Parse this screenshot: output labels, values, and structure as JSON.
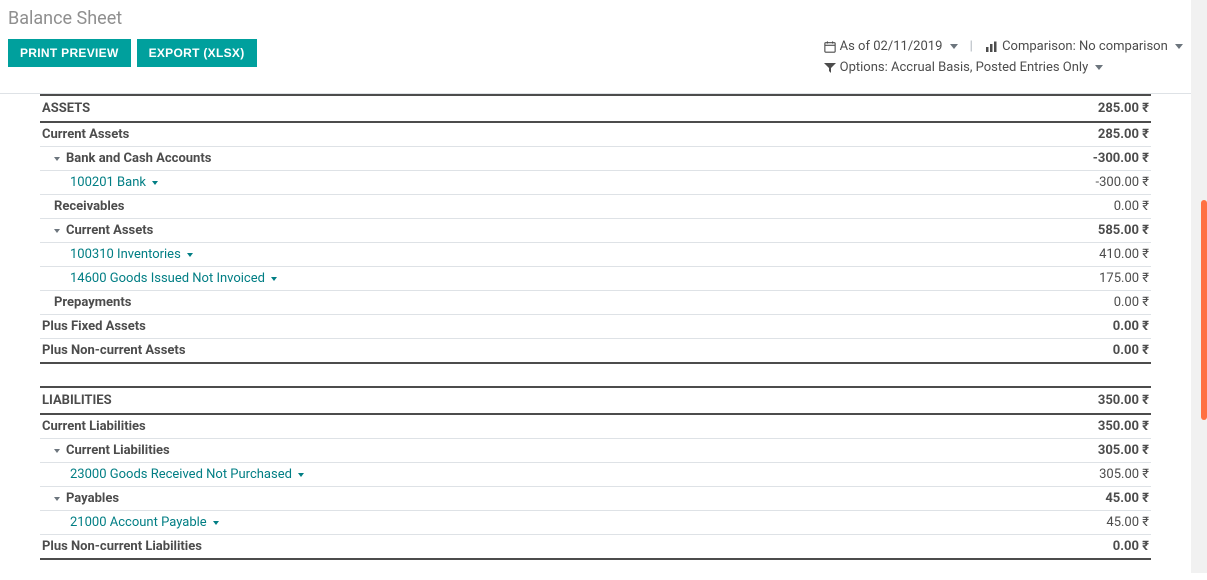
{
  "title": "Balance Sheet",
  "buttons": {
    "print": "PRINT PREVIEW",
    "export": "EXPORT (XLSX)"
  },
  "filters": {
    "asof_label": "As of",
    "asof_date": "02/11/2019",
    "comparison_label": "Comparison:",
    "comparison_value": "No comparison",
    "options_label": "Options:",
    "options_value": "Accrual Basis, Posted Entries Only"
  },
  "lines": {
    "assets": {
      "label": "ASSETS",
      "amount": "285.00 ₹"
    },
    "curr_assets_hdr": {
      "label": "Current Assets",
      "amount": "285.00 ₹"
    },
    "bank_cash": {
      "label": "Bank and Cash Accounts",
      "amount": "-300.00 ₹"
    },
    "bank": {
      "label": "100201 Bank",
      "amount": "-300.00 ₹"
    },
    "receivables": {
      "label": "Receivables",
      "amount": "0.00 ₹"
    },
    "curr_assets": {
      "label": "Current Assets",
      "amount": "585.00 ₹"
    },
    "inventories": {
      "label": "100310 Inventories",
      "amount": "410.00 ₹"
    },
    "goods_issued": {
      "label": "14600 Goods Issued Not Invoiced",
      "amount": "175.00 ₹"
    },
    "prepayments": {
      "label": "Prepayments",
      "amount": "0.00 ₹"
    },
    "plus_fixed": {
      "label": "Plus Fixed Assets",
      "amount": "0.00 ₹"
    },
    "plus_nca": {
      "label": "Plus Non-current Assets",
      "amount": "0.00 ₹"
    },
    "liabilities": {
      "label": "LIABILITIES",
      "amount": "350.00 ₹"
    },
    "curr_liab_hdr": {
      "label": "Current Liabilities",
      "amount": "350.00 ₹"
    },
    "curr_liab": {
      "label": "Current Liabilities",
      "amount": "305.00 ₹"
    },
    "goods_recv": {
      "label": "23000 Goods Received Not Purchased",
      "amount": "305.00 ₹"
    },
    "payables": {
      "label": "Payables",
      "amount": "45.00 ₹"
    },
    "acct_payable": {
      "label": "21000 Account Payable",
      "amount": "45.00 ₹"
    },
    "plus_ncl": {
      "label": "Plus Non-current Liabilities",
      "amount": "0.00 ₹"
    }
  }
}
